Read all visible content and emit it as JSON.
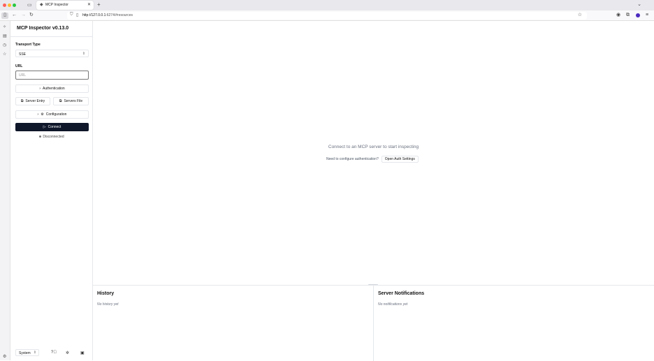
{
  "browser": {
    "tab_title": "MCP Inspector",
    "tab_close": "✕",
    "new_tab": "+",
    "url_host": "http://127.0.0.1",
    "url_rest": ":6274/#resources"
  },
  "sidebar": {
    "title": "MCP Inspector v0.13.0",
    "transport_label": "Transport Type",
    "transport_value": "SSE",
    "url_label": "URL",
    "url_placeholder": "URL",
    "authentication_label": "Authentication",
    "server_entry_label": "Server Entry",
    "servers_file_label": "Servers File",
    "configuration_label": "Configuration",
    "connect_label": "Connect",
    "status_text": "Disconnected",
    "theme_value": "System"
  },
  "main": {
    "empty_message": "Connect to an MCP server to start inspecting",
    "auth_question": "Need to configure authentication?",
    "auth_button": "Open Auth Settings"
  },
  "history": {
    "title": "History",
    "empty": "No history yet"
  },
  "notifications": {
    "title": "Server Notifications",
    "empty": "No notifications yet"
  },
  "colors": {
    "connect_bg": "#0f172a",
    "muted_text": "#6b7280"
  }
}
